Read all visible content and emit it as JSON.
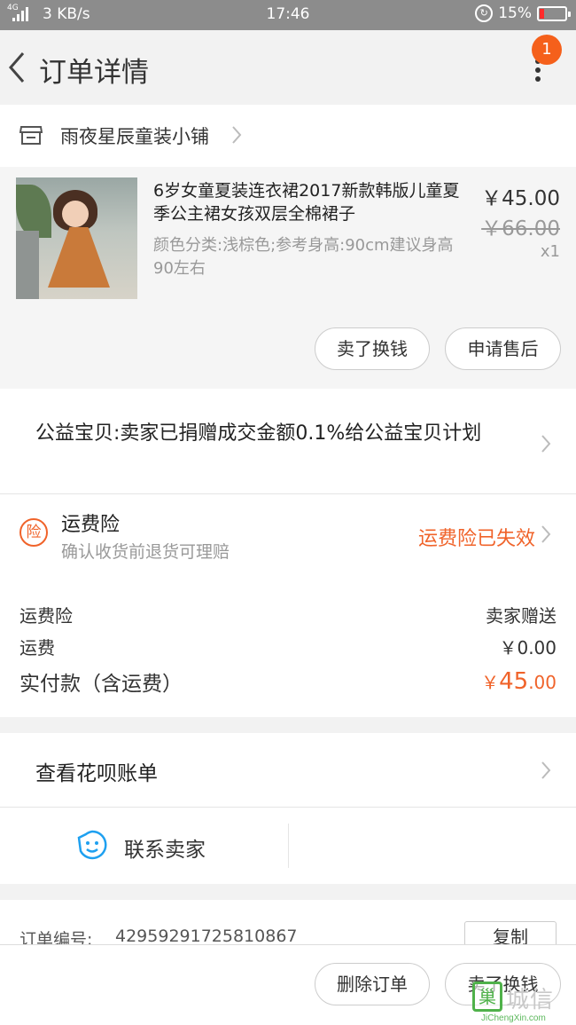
{
  "status_bar": {
    "network": "4G",
    "speed": "3 KB/s",
    "time": "17:46",
    "battery": "15%",
    "battery_color": "#ff2a2a"
  },
  "header": {
    "title": "订单详情",
    "badge_count": "1",
    "badge_color": "#f5601b"
  },
  "shop": {
    "name": "雨夜星辰童装小铺",
    "icon": "store-icon"
  },
  "item": {
    "title": "6岁女童夏装连衣裙2017新款韩版儿童夏季公主裙女孩双层全棉裙子",
    "sku": "颜色分类:浅棕色;参考身高:90cm建议身高90左右",
    "price": "￥45.00",
    "original_price": "￥66.00",
    "quantity": "x1",
    "actions": [
      "卖了换钱",
      "申请售后"
    ]
  },
  "charity": {
    "text": "公益宝贝:卖家已捐赠成交金额0.1%给公益宝贝计划"
  },
  "insurance": {
    "icon_char": "险",
    "title": "运费险",
    "subtitle": "确认收货前退货可理赔",
    "status": "运费险已失效",
    "accent": "#f0632a"
  },
  "fees": {
    "rows": [
      {
        "label": "运费险",
        "value": "卖家赠送"
      },
      {
        "label": "运费",
        "value": "￥0.00"
      }
    ],
    "paid_label": "实付款（含运费）",
    "paid_symbol": "￥",
    "paid_int": "45",
    "paid_dec": ".00"
  },
  "huabei": {
    "text": "查看花呗账单"
  },
  "contact": {
    "text": "联系卖家",
    "icon": "chat-face-icon",
    "icon_color": "#1ea0f0"
  },
  "order": {
    "label": "订单编号:",
    "number": "42959291725810867",
    "copy_label": "复制"
  },
  "bottom": {
    "delete_label": "删除订单",
    "sell_label": "卖了换钱"
  },
  "watermark": {
    "box_char": "巢",
    "cn": "城信",
    "en": "JiChengXin.com"
  }
}
